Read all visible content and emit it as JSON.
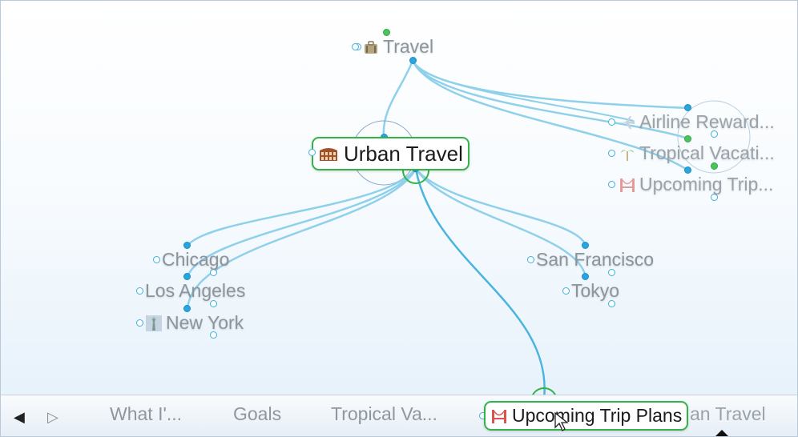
{
  "colors": {
    "link": "#7fcbe6",
    "active_border": "#33b34a",
    "gate_blue": "#2aa6df",
    "gate_green": "#4cc45e"
  },
  "brain": {
    "parent": {
      "label": "Travel",
      "icon": "suitcase-icon"
    },
    "central": {
      "label": "Urban Travel",
      "icon": "colosseum-icon"
    },
    "jumps": [
      {
        "label": "Airline Reward...",
        "icon": "airplane-icon"
      },
      {
        "label": "Tropical Vacati...",
        "icon": "palm-tree-icon"
      },
      {
        "label": "Upcoming Trip...",
        "icon": "bridge-icon"
      }
    ],
    "children": [
      {
        "label": "Chicago",
        "icon": ""
      },
      {
        "label": "Los Angeles",
        "icon": ""
      },
      {
        "label": "New York",
        "icon": "statue-of-liberty-icon"
      },
      {
        "label": "San Francisco",
        "icon": ""
      },
      {
        "label": "Tokyo",
        "icon": ""
      }
    ]
  },
  "pins": {
    "prev_icon": "left-arrow-icon",
    "next_icon": "right-arrow-icon",
    "items": [
      {
        "label": "What I'...",
        "icon": "lightbulb-icon"
      },
      {
        "label": "Goals",
        "icon": "flag-icon"
      },
      {
        "label": "Tropical Va...",
        "icon": "palm-tree-icon"
      },
      {
        "label": "Upcoming Trip Plans",
        "icon": "bridge-icon"
      },
      {
        "label": "an Travel",
        "icon": ""
      }
    ]
  }
}
